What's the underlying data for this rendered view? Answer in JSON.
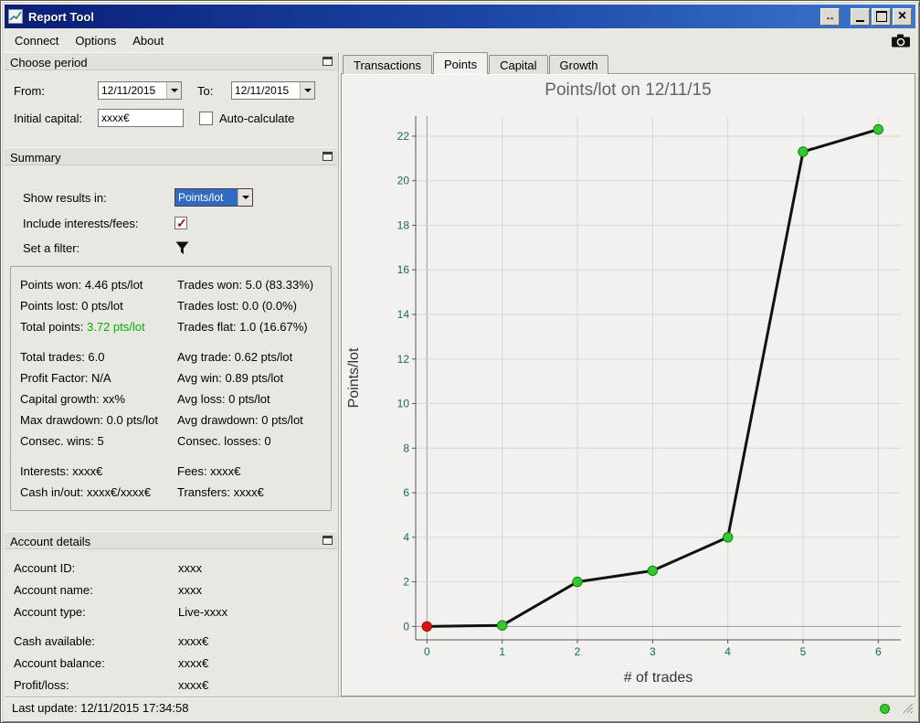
{
  "colors": {
    "titlebar_left": "#0a1e78",
    "titlebar_right": "#3c78cc",
    "selection_blue": "#316ac5",
    "total_points_green": "#00b400",
    "tick_label_teal": "#116a6a",
    "point_green": "#2ecc2e",
    "point_red": "#e01010",
    "status_dot_green": "#2ecc2e"
  },
  "titlebar": {
    "title": "Report Tool",
    "icons": [
      "app-icon",
      "detach-icon",
      "minimize-icon",
      "maximize-icon",
      "close-icon"
    ]
  },
  "menu": {
    "items": [
      "Connect",
      "Options",
      "About"
    ],
    "camera_icon": "camera-icon"
  },
  "choose_period": {
    "title": "Choose period",
    "from_label": "From:",
    "from_value": "12/11/2015",
    "to_label": "To:",
    "to_value": "12/11/2015",
    "initial_capital_label": "Initial capital:",
    "initial_capital_value": "xxxx€",
    "auto_calculate_label": "Auto-calculate"
  },
  "summary": {
    "title": "Summary",
    "show_results_label": "Show results in:",
    "show_results_value": "Points/lot",
    "include_label": "Include interests/fees:",
    "include_checked": true,
    "filter_label": "Set a filter:",
    "stats": {
      "rows_a": [
        {
          "left": "Points won: 4.46 pts/lot",
          "right": "Trades won: 5.0 (83.33%)"
        },
        {
          "left": "Points lost: 0 pts/lot",
          "right": "Trades lost: 0.0 (0.0%)"
        }
      ],
      "total_points_label": "Total points:",
      "total_points_value": "3.72 pts/lot",
      "total_points_right": "Trades flat: 1.0 (16.67%)",
      "rows_b": [
        {
          "left": "Total trades: 6.0",
          "right": "Avg trade: 0.62 pts/lot"
        },
        {
          "left": "Profit Factor: N/A",
          "right": "Avg win: 0.89 pts/lot"
        },
        {
          "left": "Capital growth: xx%",
          "right": "Avg loss: 0 pts/lot"
        },
        {
          "left": "Max drawdown: 0.0 pts/lot",
          "right": "Avg drawdown: 0 pts/lot"
        },
        {
          "left": "Consec. wins: 5",
          "right": "Consec. losses: 0"
        }
      ],
      "rows_c": [
        {
          "left": "Interests: xxxx€",
          "right": "Fees: xxxx€"
        },
        {
          "left": "Cash in/out: xxxx€/xxxx€",
          "right": "Transfers: xxxx€"
        }
      ]
    }
  },
  "account": {
    "title": "Account details",
    "rows_a": [
      {
        "label": "Account ID:",
        "value": "xxxx"
      },
      {
        "label": "Account name:",
        "value": "xxxx"
      },
      {
        "label": "Account type:",
        "value": "Live-xxxx"
      }
    ],
    "rows_b": [
      {
        "label": "Cash available:",
        "value": "xxxx€"
      },
      {
        "label": "Account balance:",
        "value": "xxxx€"
      },
      {
        "label": "Profit/loss:",
        "value": "xxxx€"
      }
    ]
  },
  "statusbar": {
    "last_update": "Last update: 12/11/2015 17:34:58"
  },
  "tabs": {
    "items": [
      {
        "label": "Transactions",
        "active": false
      },
      {
        "label": "Points",
        "active": true
      },
      {
        "label": "Capital",
        "active": false
      },
      {
        "label": "Growth",
        "active": false
      }
    ]
  },
  "chart_data": {
    "type": "line",
    "title": "Points/lot on 12/11/15",
    "xlabel": "# of trades",
    "ylabel": "Points/lot",
    "x": [
      0,
      1,
      2,
      3,
      4,
      5,
      6
    ],
    "y": [
      0,
      0.05,
      2,
      2.5,
      4,
      21.3,
      22.3
    ],
    "point_colors": [
      "#e01010",
      "#2ecc2e",
      "#2ecc2e",
      "#2ecc2e",
      "#2ecc2e",
      "#2ecc2e",
      "#2ecc2e"
    ],
    "line_color": "#111111",
    "xticks": [
      0,
      1,
      2,
      3,
      4,
      5,
      6
    ],
    "yticks": [
      0,
      2,
      4,
      6,
      8,
      10,
      12,
      14,
      16,
      18,
      20,
      22
    ],
    "xlim": [
      -0.15,
      6.3
    ],
    "ylim": [
      -0.6,
      22.9
    ],
    "grid": true,
    "legend": false
  }
}
